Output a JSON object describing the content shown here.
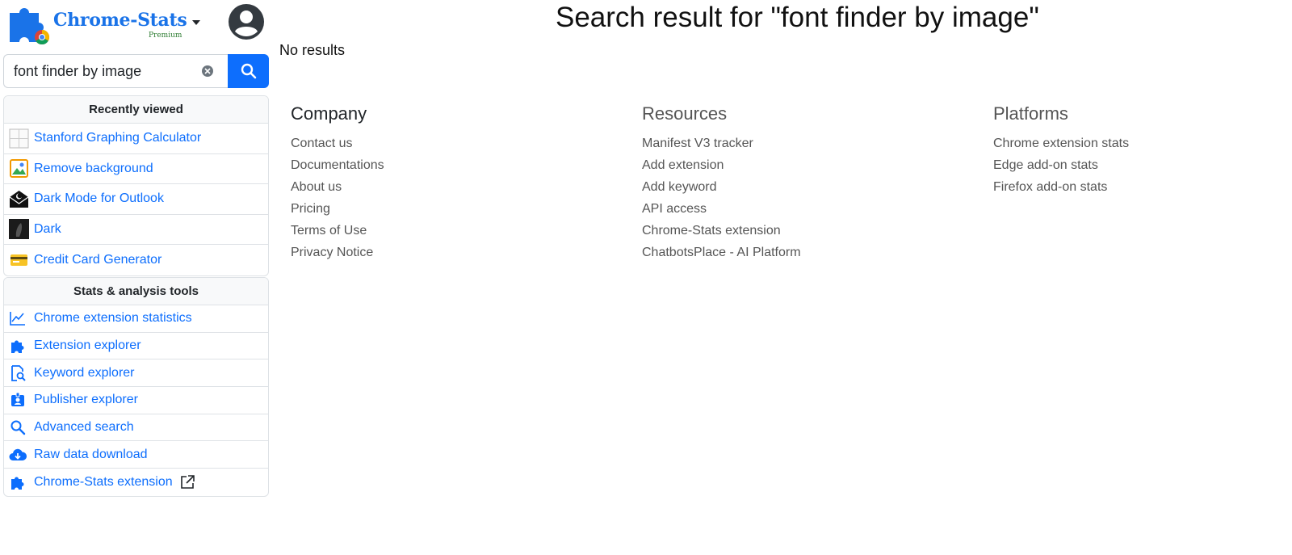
{
  "brand": {
    "name": "Chrome-Stats",
    "sub": "Premium"
  },
  "search": {
    "value": "font finder by image",
    "placeholder": ""
  },
  "recently_viewed": {
    "title": "Recently viewed",
    "items": [
      {
        "label": "Stanford Graphing Calculator",
        "icon": "graph-paper-thumb"
      },
      {
        "label": "Remove background",
        "icon": "photo-thumb"
      },
      {
        "label": "Dark Mode for Outlook",
        "icon": "envelope-thumb"
      },
      {
        "label": "Dark",
        "icon": "dark-thumb"
      },
      {
        "label": "Credit Card Generator",
        "icon": "credit-card-thumb"
      }
    ]
  },
  "tools": {
    "title": "Stats & analysis tools",
    "items": [
      {
        "label": "Chrome extension statistics",
        "icon": "chart-line-icon"
      },
      {
        "label": "Extension explorer",
        "icon": "puzzle-icon"
      },
      {
        "label": "Keyword explorer",
        "icon": "keyword-search-icon"
      },
      {
        "label": "Publisher explorer",
        "icon": "badge-icon"
      },
      {
        "label": "Advanced search",
        "icon": "search-icon"
      },
      {
        "label": "Raw data download",
        "icon": "cloud-download-icon"
      },
      {
        "label": "Chrome-Stats extension",
        "icon": "puzzle-icon"
      }
    ]
  },
  "main": {
    "title": "Search result for \"font finder by image\"",
    "no_results": "No results"
  },
  "footer": {
    "company": {
      "title": "Company",
      "links": [
        "Contact us",
        "Documentations",
        "About us",
        "Pricing",
        "Terms of Use",
        "Privacy Notice"
      ]
    },
    "resources": {
      "title": "Resources",
      "links": [
        "Manifest V3 tracker",
        "Add extension",
        "Add keyword",
        "API access",
        "Chrome-Stats extension",
        "ChatbotsPlace - AI Platform"
      ]
    },
    "platforms": {
      "title": "Platforms",
      "links": [
        "Chrome extension stats",
        "Edge add-on stats",
        "Firefox add-on stats"
      ]
    }
  },
  "colors": {
    "accent": "#0d6efd",
    "brand": "#1a73e8"
  }
}
